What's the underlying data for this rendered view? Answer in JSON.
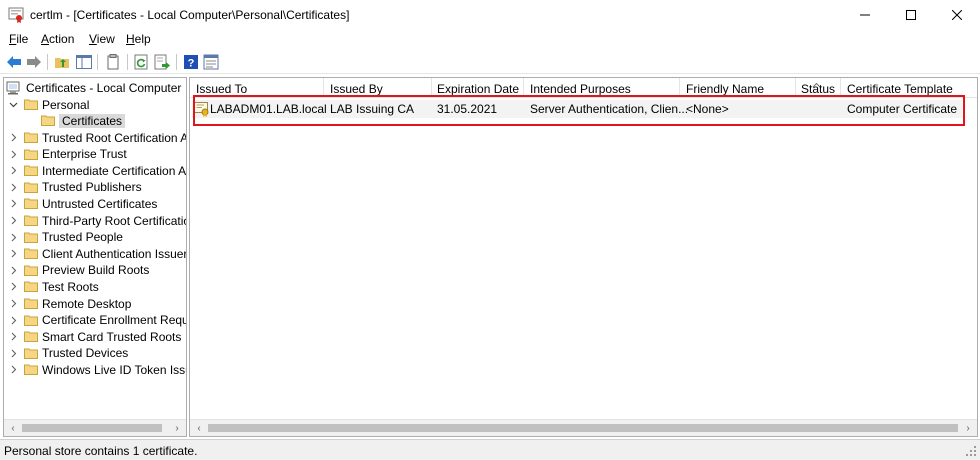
{
  "window": {
    "title": "certlm - [Certificates - Local Computer\\Personal\\Certificates]",
    "icon": "certificate-app-icon",
    "controls": [
      "minimize-icon",
      "maximize-icon",
      "close-icon"
    ]
  },
  "menu": {
    "items": [
      {
        "label": "File",
        "underline": "F"
      },
      {
        "label": "Action",
        "underline": "A"
      },
      {
        "label": "View",
        "underline": "V"
      },
      {
        "label": "Help",
        "underline": "H"
      }
    ]
  },
  "toolbar": {
    "buttons": [
      "back-arrow-icon",
      "forward-arrow-icon",
      "up-folder-icon",
      "show-hide-tree-icon",
      "delete-icon",
      "refresh-icon",
      "export-list-icon",
      "help-icon",
      "properties-icon"
    ]
  },
  "tree": {
    "root": "Certificates - Local Computer",
    "personal": "Personal",
    "certificates": "Certificates",
    "stores": [
      "Trusted Root Certification Au",
      "Enterprise Trust",
      "Intermediate Certification Au",
      "Trusted Publishers",
      "Untrusted Certificates",
      "Third-Party Root Certification",
      "Trusted People",
      "Client Authentication Issuers",
      "Preview Build Roots",
      "Test Roots",
      "Remote Desktop",
      "Certificate Enrollment Reques",
      "Smart Card Trusted Roots",
      "Trusted Devices",
      "Windows Live ID Token Issuer"
    ]
  },
  "list": {
    "columns": [
      "Issued To",
      "Issued By",
      "Expiration Date",
      "Intended Purposes",
      "Friendly Name",
      "Status",
      "Certificate Template"
    ],
    "sorted_column": "Status",
    "rows": [
      {
        "issued_to": "LABADM01.LAB.local",
        "issued_by": "LAB Issuing CA",
        "expiration": "31.05.2021",
        "purposes": "Server Authentication, Clien...",
        "friendly_name": "<None>",
        "status": "",
        "template": "Computer Certificate"
      }
    ],
    "highlight_color": "#e0141b"
  },
  "status_bar": {
    "text": "Personal store contains 1 certificate."
  }
}
